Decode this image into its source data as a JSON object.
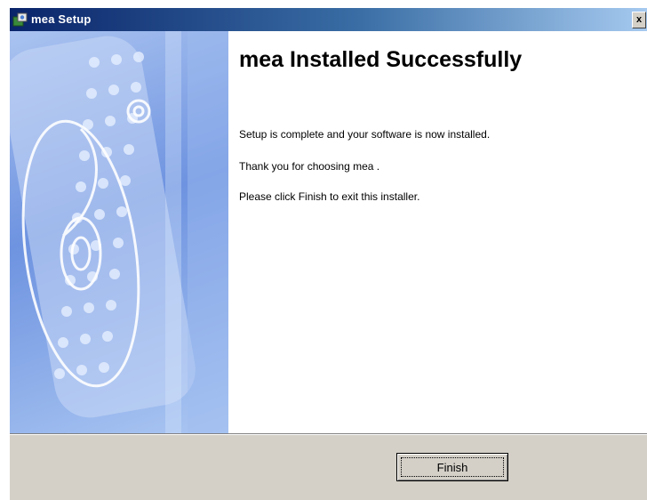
{
  "window": {
    "title": "mea Setup",
    "close_glyph": "x",
    "app_icon": "installer-app-icon",
    "close_icon": "close-icon"
  },
  "banner": {
    "icon": "installer-banner-art"
  },
  "content": {
    "heading": "mea Installed Successfully",
    "messages": [
      "Setup is complete and your software is now installed.",
      "Thank you for choosing mea .",
      "Please click Finish to exit this installer."
    ]
  },
  "footer": {
    "finish_label": "Finish"
  },
  "colors": {
    "titlebar_start": "#0a246a",
    "titlebar_end": "#a6caf0",
    "face": "#d4d0c8",
    "banner": "#6e93e0"
  }
}
